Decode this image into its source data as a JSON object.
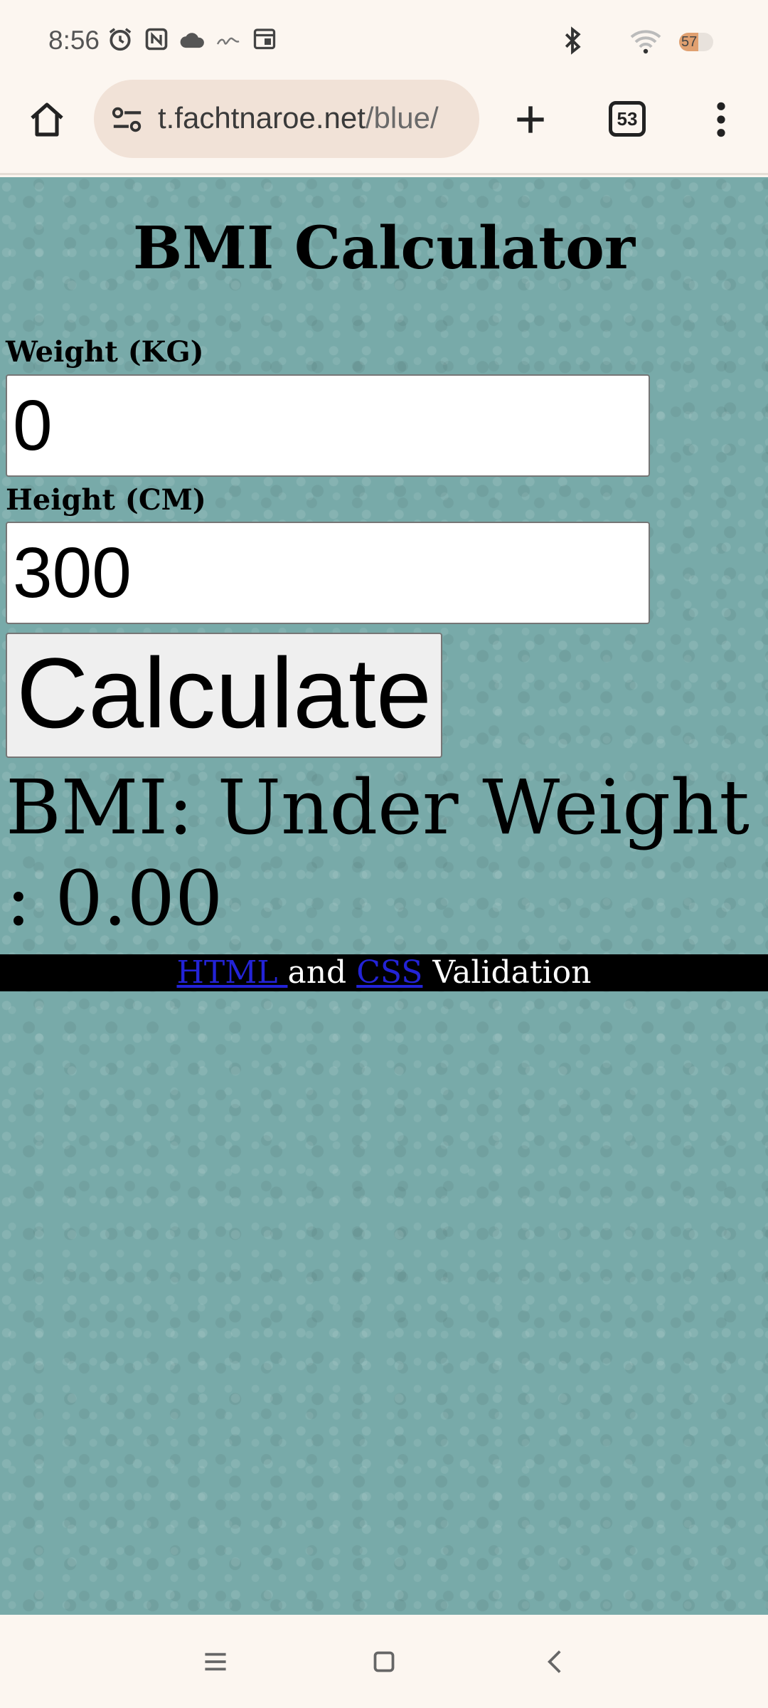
{
  "status_bar": {
    "time": "8:56",
    "battery_level": "57",
    "battery_fraction": 0.57
  },
  "browser": {
    "url_host": "t.fachtnaroe.net",
    "url_path": "/blue/",
    "tab_count": "53"
  },
  "page": {
    "title": "BMI Calculator",
    "weight_label": "Weight (KG)",
    "weight_value": "0",
    "height_label": "Height (CM)",
    "height_value": "300",
    "calculate_label": "Calculate",
    "result_text": "BMI: Under Weight : 0.00"
  },
  "footer": {
    "html_link": "HTML ",
    "and_text": "and",
    "css_link": "CSS",
    "validation_text": "Validation"
  },
  "colors": {
    "page_background": "#78aaa9",
    "footer_background": "#000000",
    "link": "#2323d6",
    "chrome": "#fcf6f0",
    "url_bar": "#f1e2d7"
  },
  "icons": [
    "alarm-icon",
    "nfc-icon",
    "cloud-icon",
    "calendar-icon",
    "bluetooth-icon",
    "wifi-icon",
    "home-icon",
    "site-settings-icon",
    "plus-icon",
    "more-vert-icon",
    "recents-icon",
    "home-nav-icon",
    "back-icon"
  ]
}
